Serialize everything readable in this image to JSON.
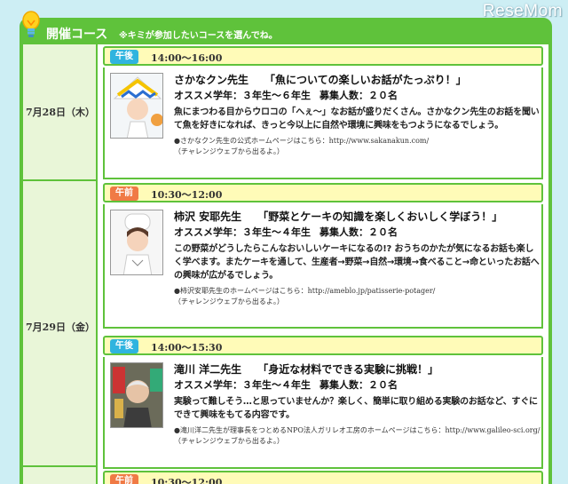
{
  "watermark": "ReseMom",
  "header": {
    "title": "開催コース",
    "note": "※キミが参加したいコースを選んでね。"
  },
  "dates": [
    {
      "label": "7月28日（木）"
    },
    {
      "label": "7月29日（金）"
    }
  ],
  "slots": [
    {
      "period": "午後",
      "time": "14:00～16:00",
      "teacher": "さかなクン先生",
      "title": "「魚についての楽しいお話がたっぷり！」",
      "grade": "オススメ学年：３年生～６年生",
      "capacity": "募集人数：２０名",
      "description": "魚にまつわる目からウロコの「へぇ～」なお話が盛りだくさん。さかなクン先生のお話を聞いて魚を好きになれば、きっと今以上に自然や環境に興味をもつようになるでしょう。",
      "link_note": "●さかなクン先生の公式ホームページはこちら：http://www.sakanakun.com/",
      "exit_note": "（チャレンジウェブから出るよ。）"
    },
    {
      "period": "午前",
      "time": "10:30～12:00",
      "teacher": "柿沢 安耶先生",
      "title": "「野菜とケーキの知識を楽しくおいしく学ぼう！」",
      "grade": "オススメ学年：３年生～４年生",
      "capacity": "募集人数：２０名",
      "description": "この野菜がどうしたらこんなおいしいケーキになるの!? おうちのかたが気になるお話も楽しく学べます。またケーキを通して、生産者→野菜→自然→環境→食べること→命といったお話への興味が広がるでしょう。",
      "link_note": "●柿沢安耶先生のホームページはこちら：http://ameblo.jp/patisserie-potager/",
      "exit_note": "（チャレンジウェブから出るよ。）"
    },
    {
      "period": "午後",
      "time": "14:00～15:30",
      "teacher": "滝川 洋二先生",
      "title": "「身近な材料でできる実験に挑戦！」",
      "grade": "オススメ学年：３年生～４年生",
      "capacity": "募集人数：２０名",
      "description": "実験って難しそう…と思っていませんか？楽しく、簡単に取り組める実験のお話など、すぐにできて興味をもてる内容です。",
      "link_note": "●滝川洋二先生が理事長をつとめるNPO法人ガリレオ工房のホームページはこちら：http://www.galileo-sci.org/",
      "exit_note": "（チャレンジウェブから出るよ。）"
    },
    {
      "period": "午前",
      "time": "10:30～12:00"
    }
  ],
  "colors": {
    "accent_green": "#5fc23b",
    "time_bar_yellow": "#fffbb8",
    "tag_pm": "#2fb4df",
    "tag_am": "#f07a45",
    "background": "#cdeef4"
  }
}
